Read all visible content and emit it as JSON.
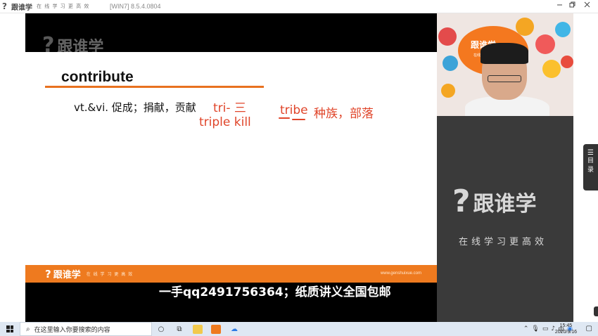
{
  "window": {
    "brand": "跟谁学",
    "slogan": "在 线 学 习 更 高 效",
    "version": "[WIN7] 8.5.4.0804",
    "minimize_icon": "minimize-icon",
    "restore_icon": "restore-icon",
    "close_icon": "close-icon"
  },
  "slide": {
    "watermark": "跟谁学",
    "word": "contribute",
    "definition": "vt.&vi. 促成；捐献，贡献",
    "notes": {
      "prefix": "tri- 三",
      "example": "triple kill",
      "tribe": "tribe",
      "tribe_meaning": "种族，部落"
    },
    "footer_brand": "跟谁学",
    "footer_slogan": "在 线 学 习 更 高 效",
    "footer_url": "www.genshuixue.com",
    "subtitle": "一手qq2491756364；纸质讲义全国包邮"
  },
  "camera": {
    "logo_brand": "跟谁学",
    "logo_slogan": "在线学习更高效"
  },
  "side_panel": {
    "brand": "跟谁学",
    "slogan": "在线学习更高效"
  },
  "toc": {
    "icon": "list-icon",
    "label_1": "目",
    "label_2": "录"
  },
  "taskbar": {
    "search_placeholder": "在这里输入你要搜索的内容",
    "time": "15:45",
    "date": "2020/9/16"
  },
  "colors": {
    "accent": "#ee7a1f",
    "note_red": "#e0452a",
    "panel": "#3a3a3a"
  }
}
